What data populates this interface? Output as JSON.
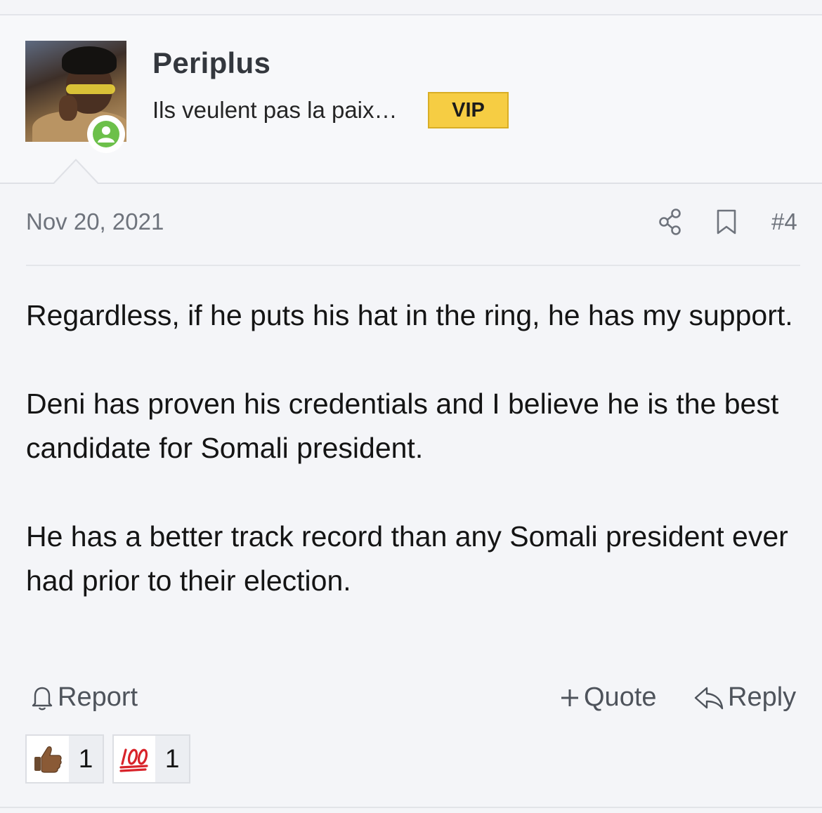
{
  "user": {
    "name": "Periplus",
    "title": "Ils veulent pas la paix…",
    "badge": "VIP",
    "online": true
  },
  "post": {
    "date": "Nov 20, 2021",
    "number": "#4",
    "paragraphs": [
      "Regardless, if he puts his hat in the ring, he has my support.",
      "Deni has proven his credentials and I believe he is the best candidate for Somali president.",
      "He has a better track record than any Somali president ever had prior to their election."
    ]
  },
  "actions": {
    "report": "Report",
    "quote": "Quote",
    "reply": "Reply"
  },
  "reactions": [
    {
      "icon": "thumbs-up",
      "count": "1"
    },
    {
      "icon": "hundred-points",
      "count": "1"
    }
  ],
  "colors": {
    "vip_badge": "#f6cd43",
    "online_indicator": "#6cc04a",
    "muted_text": "#6e737c"
  }
}
